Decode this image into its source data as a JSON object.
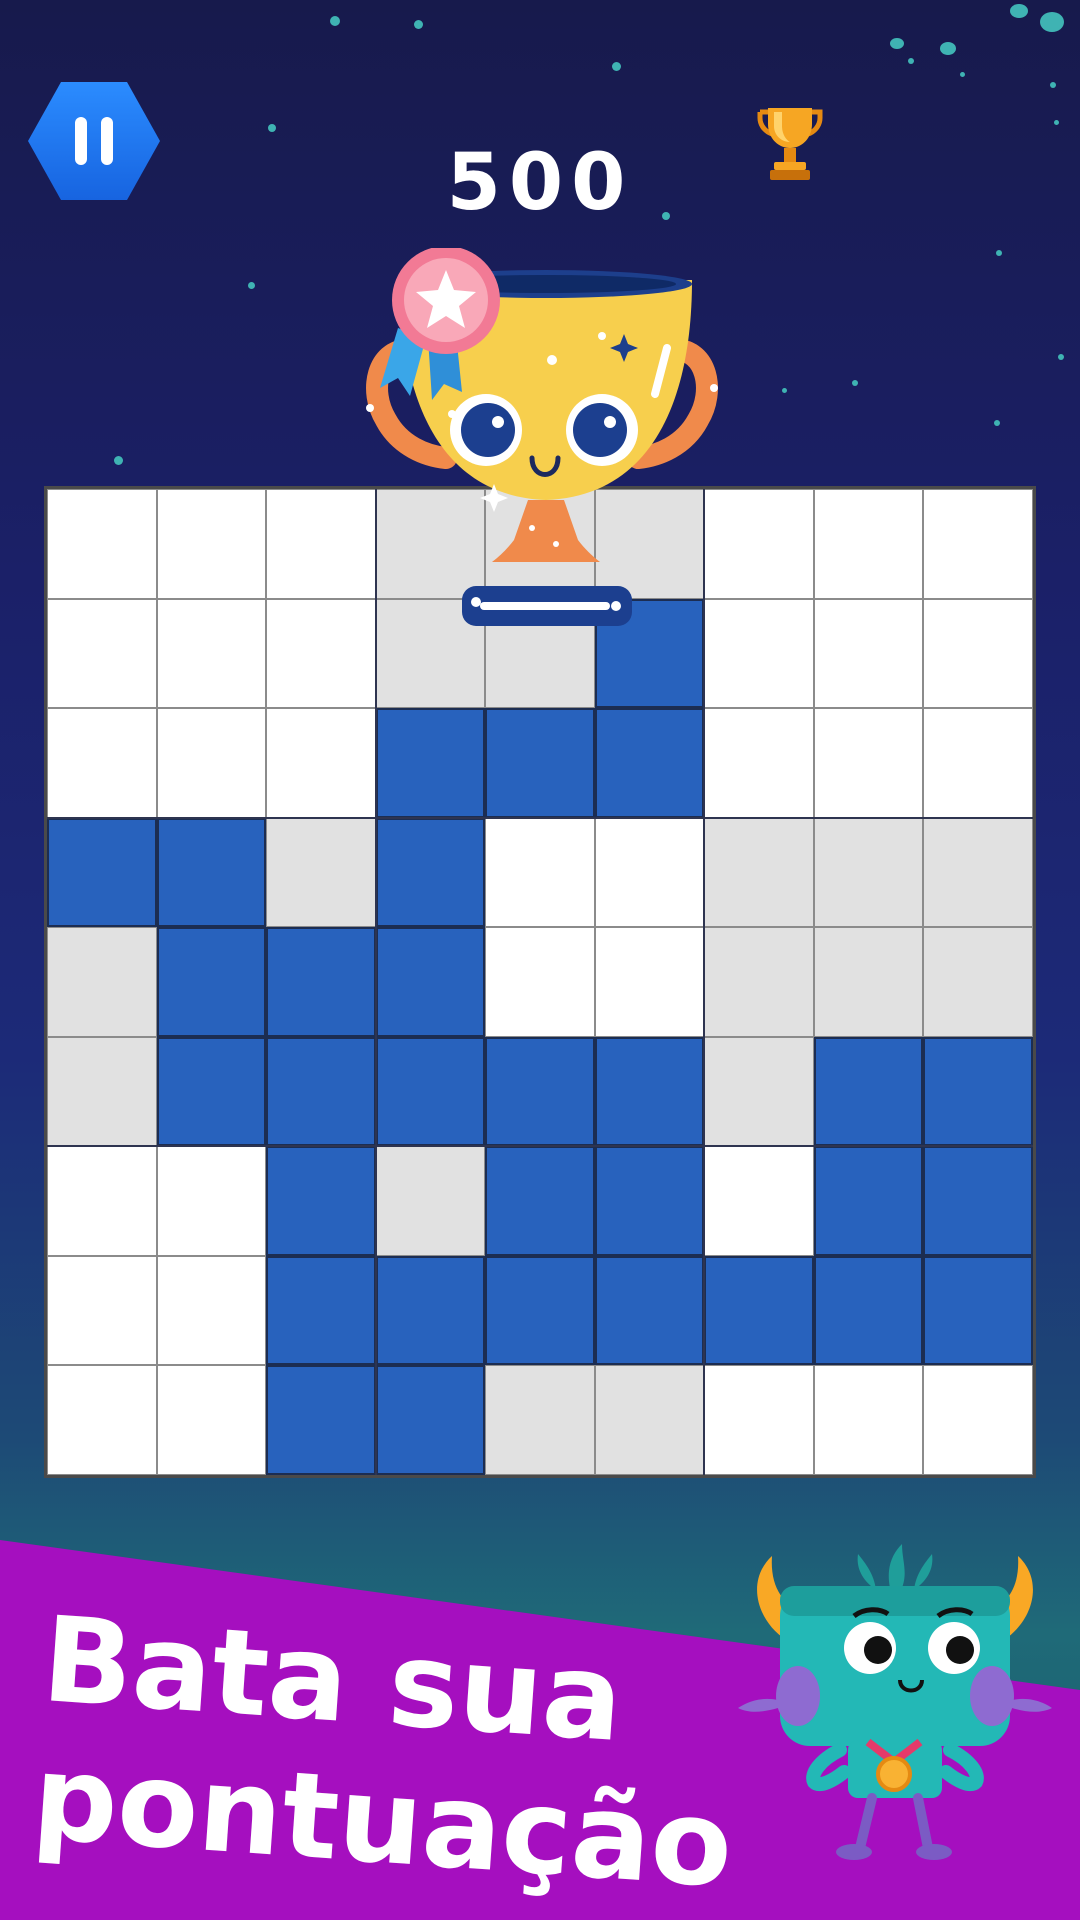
{
  "hud": {
    "score": "500",
    "pause_icon": "pause-icon",
    "best_score_icon": "trophy-icon"
  },
  "board": {
    "rows": 9,
    "cols": 9,
    "cells": [
      [
        "W",
        "W",
        "W",
        "G",
        "G",
        "G",
        "W",
        "W",
        "W"
      ],
      [
        "W",
        "W",
        "W",
        "G",
        "G",
        "B",
        "W",
        "W",
        "W"
      ],
      [
        "W",
        "W",
        "W",
        "B",
        "B",
        "B",
        "W",
        "W",
        "W"
      ],
      [
        "B",
        "B",
        "G",
        "B",
        "W",
        "W",
        "G",
        "G",
        "G"
      ],
      [
        "G",
        "B",
        "B",
        "B",
        "W",
        "W",
        "G",
        "G",
        "G"
      ],
      [
        "G",
        "B",
        "B",
        "B",
        "B",
        "B",
        "G",
        "B",
        "B"
      ],
      [
        "W",
        "W",
        "B",
        "G",
        "B",
        "B",
        "W",
        "B",
        "B"
      ],
      [
        "W",
        "W",
        "B",
        "B",
        "B",
        "B",
        "B",
        "B",
        "B"
      ],
      [
        "W",
        "W",
        "B",
        "B",
        "G",
        "G",
        "W",
        "W",
        "W"
      ]
    ],
    "legend": {
      "W": "empty",
      "G": "empty-shaded-box",
      "B": "filled"
    }
  },
  "banner": {
    "line1": "Bata sua",
    "line2": "pontuação"
  },
  "colors": {
    "filled_block": "#2862bd",
    "banner": "#a50fbf",
    "pause_button": "#1f78f0",
    "trophy": "#f7cf4d",
    "monster": "#23b8b6"
  }
}
